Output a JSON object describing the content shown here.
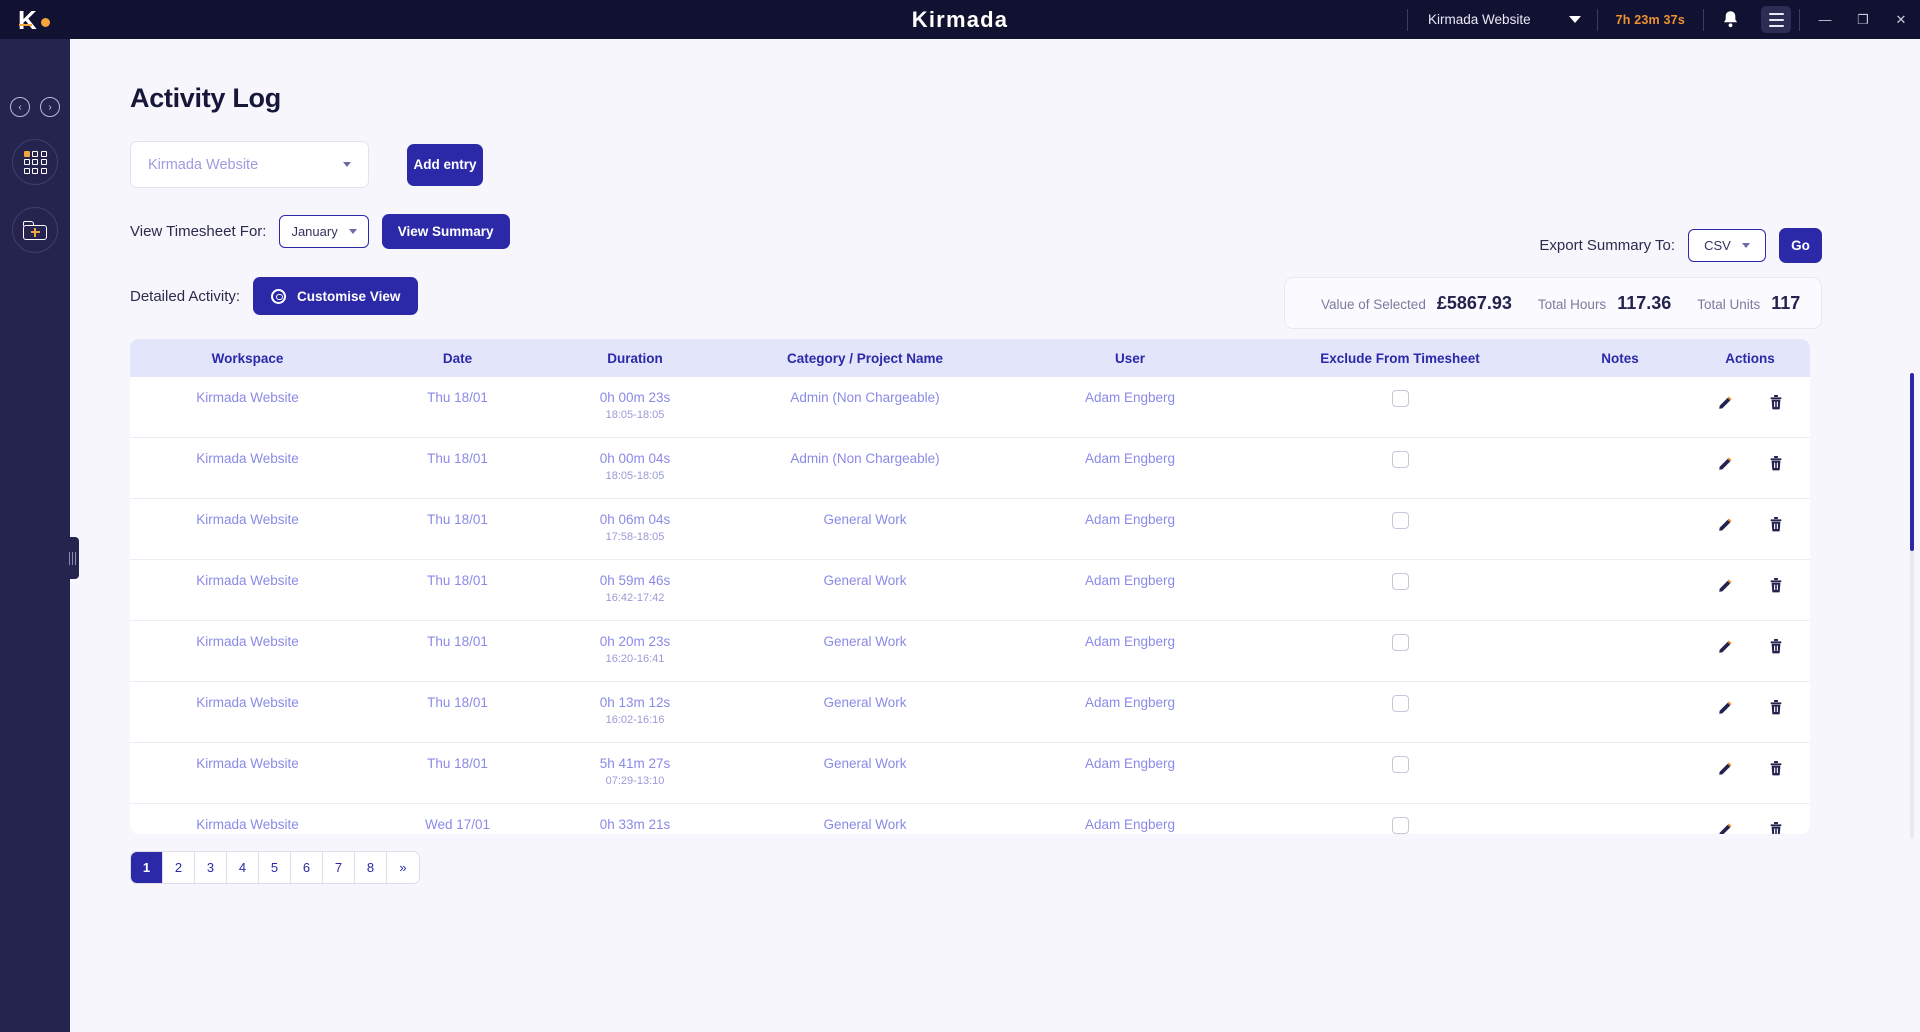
{
  "titlebar": {
    "logo_letter": "K",
    "brand": "Kirmada",
    "workspace_selector": "Kirmada Website",
    "timer": "7h 23m 37s",
    "bell_icon": "bell-icon",
    "menu_icon": "hamburger-menu-icon",
    "minimize": "—",
    "maximize": "❐",
    "close": "✕"
  },
  "rail": {
    "back": "‹",
    "forward": "›",
    "grid_icon": "grid-apps-icon",
    "folder_icon": "new-folder-icon"
  },
  "page": {
    "title": "Activity Log",
    "workspace_value": "Kirmada Website",
    "add_entry_label": "Add entry",
    "view_timesheet_label": "View Timesheet For:",
    "month_value": "January",
    "view_summary_label": "View Summary",
    "export_label": "Export Summary To:",
    "export_format": "CSV",
    "go_label": "Go",
    "detailed_activity_label": "Detailed Activity:",
    "customise_view_label": "Customise View"
  },
  "summary": {
    "value_label": "Value of Selected",
    "value": "£5867.93",
    "hours_label": "Total Hours",
    "hours": "117.36",
    "units_label": "Total Units",
    "units": "117"
  },
  "table": {
    "headers": [
      "Workspace",
      "Date",
      "Duration",
      "Category / Project Name",
      "User",
      "Exclude From Timesheet",
      "Notes",
      "Actions"
    ],
    "rows": [
      {
        "workspace": "Kirmada Website",
        "date": "Thu 18/01",
        "duration": "0h 00m 23s",
        "times": "18:05-18:05",
        "category": "Admin (Non Chargeable)",
        "user": "Adam Engberg",
        "excluded": false,
        "notes": ""
      },
      {
        "workspace": "Kirmada Website",
        "date": "Thu 18/01",
        "duration": "0h 00m 04s",
        "times": "18:05-18:05",
        "category": "Admin (Non Chargeable)",
        "user": "Adam Engberg",
        "excluded": false,
        "notes": ""
      },
      {
        "workspace": "Kirmada Website",
        "date": "Thu 18/01",
        "duration": "0h 06m 04s",
        "times": "17:58-18:05",
        "category": "General Work",
        "user": "Adam Engberg",
        "excluded": false,
        "notes": ""
      },
      {
        "workspace": "Kirmada Website",
        "date": "Thu 18/01",
        "duration": "0h 59m 46s",
        "times": "16:42-17:42",
        "category": "General Work",
        "user": "Adam Engberg",
        "excluded": false,
        "notes": ""
      },
      {
        "workspace": "Kirmada Website",
        "date": "Thu 18/01",
        "duration": "0h 20m 23s",
        "times": "16:20-16:41",
        "category": "General Work",
        "user": "Adam Engberg",
        "excluded": false,
        "notes": ""
      },
      {
        "workspace": "Kirmada Website",
        "date": "Thu 18/01",
        "duration": "0h 13m 12s",
        "times": "16:02-16:16",
        "category": "General Work",
        "user": "Adam Engberg",
        "excluded": false,
        "notes": ""
      },
      {
        "workspace": "Kirmada Website",
        "date": "Thu 18/01",
        "duration": "5h 41m 27s",
        "times": "07:29-13:10",
        "category": "General Work",
        "user": "Adam Engberg",
        "excluded": false,
        "notes": ""
      },
      {
        "workspace": "Kirmada Website",
        "date": "Wed 17/01",
        "duration": "0h 33m 21s",
        "times": "",
        "category": "General Work",
        "user": "Adam Engberg",
        "excluded": false,
        "notes": ""
      }
    ],
    "edit_icon": "pencil-edit-icon",
    "delete_icon": "trash-delete-icon"
  },
  "pagination": {
    "pages": [
      "1",
      "2",
      "3",
      "4",
      "5",
      "6",
      "7",
      "8",
      "»"
    ],
    "active": "1"
  },
  "colors": {
    "primary": "#2c29a8",
    "accent": "#f5a33c",
    "header_bg": "#111132",
    "rail_bg": "#24244f",
    "link": "#8a8ae8"
  }
}
